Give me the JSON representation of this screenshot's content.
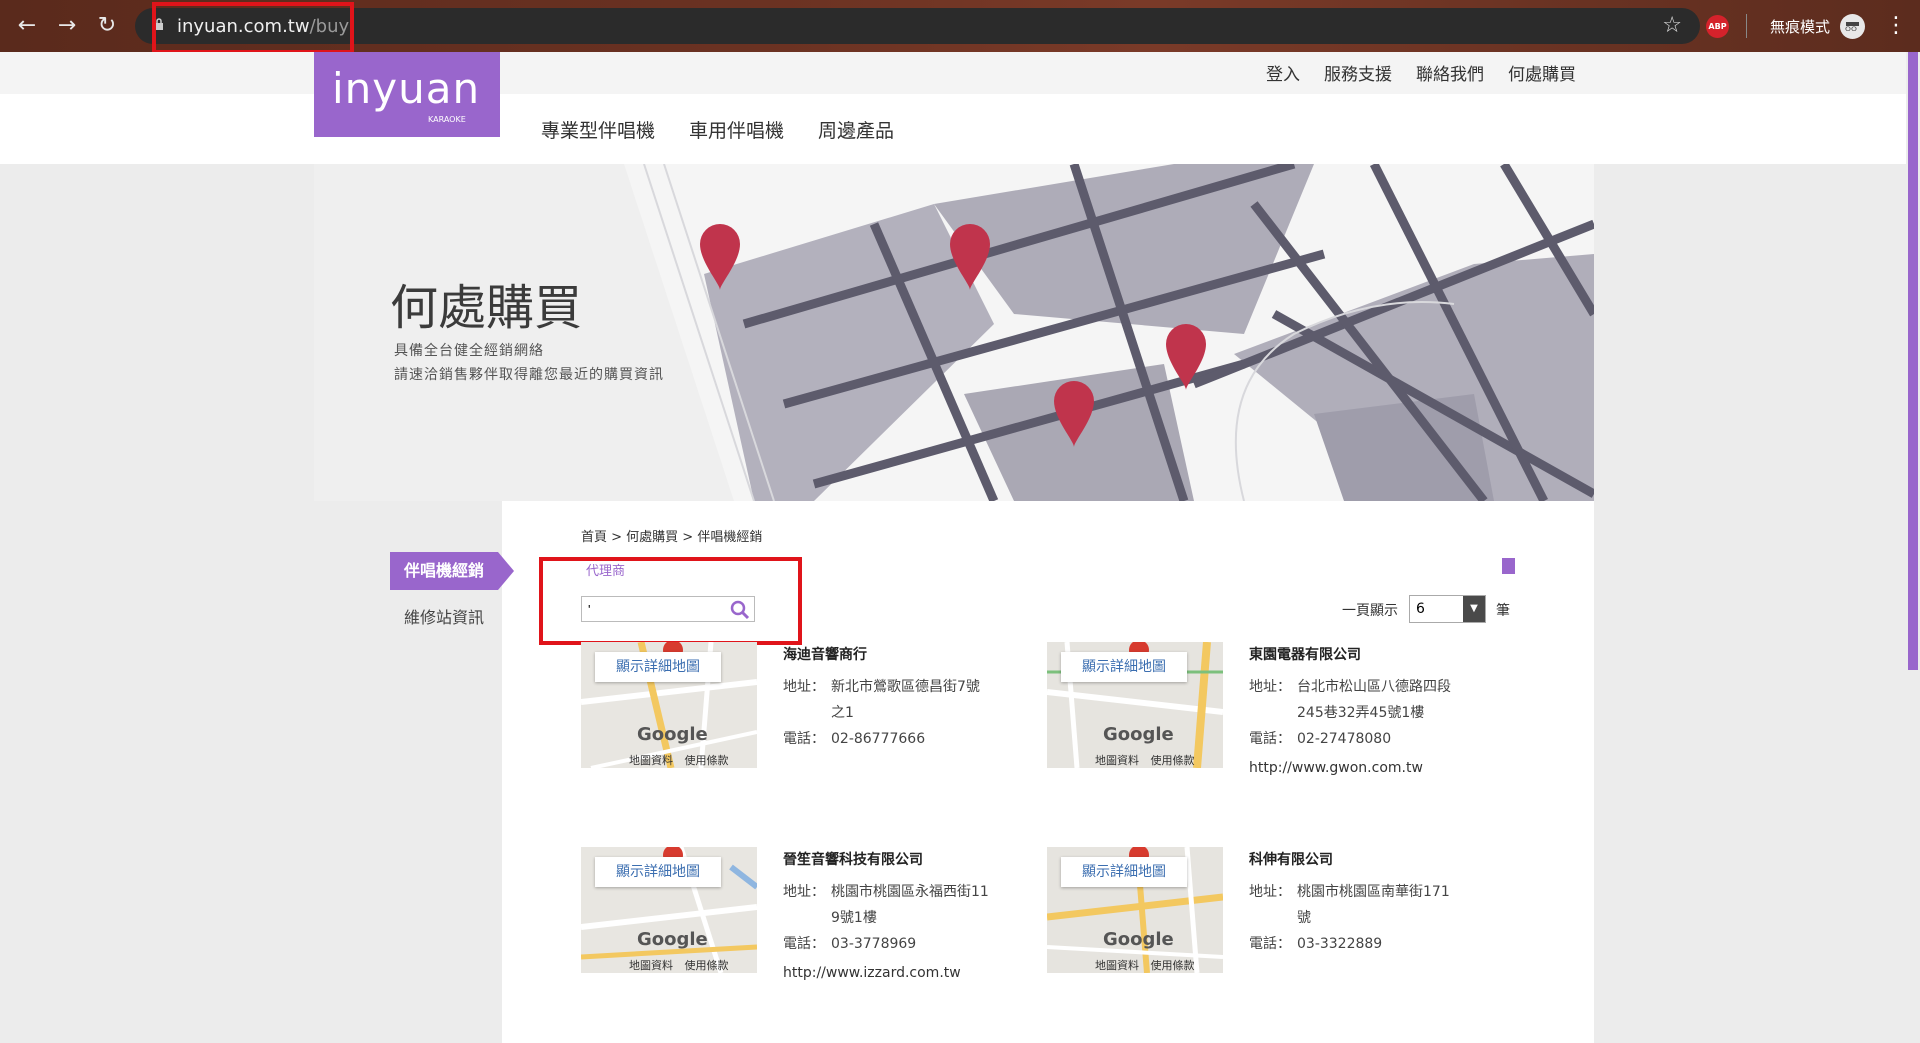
{
  "browser": {
    "url_host": "inyuan.com.tw",
    "url_path": "/buy",
    "abp_label": "ABP",
    "incognito_label": "無痕模式"
  },
  "site": {
    "logo_brand": "inyuan",
    "logo_sub": "KARAOKE",
    "top_links": [
      "登入",
      "服務支援",
      "聯絡我們",
      "何處購買"
    ],
    "main_nav": [
      "專業型伴唱機",
      "車用伴唱機",
      "周邊產品"
    ]
  },
  "banner": {
    "title": "何處購買",
    "sub1": "具備全台健全經銷網絡",
    "sub2": "請速洽銷售夥伴取得離您最近的購買資訊"
  },
  "sidebar": {
    "active": "伴唱機經銷",
    "item": "維修站資訊"
  },
  "breadcrumb": "首頁 > 何處購買 > 伴唱機經銷",
  "filter": {
    "agent_label": "代理商",
    "search_value": "'",
    "per_page_label": "一頁顯示",
    "per_page_value": "6",
    "per_page_unit": "筆"
  },
  "map_common": {
    "show_map": "顯示詳細地圖",
    "google": "Google",
    "footer": "地圖資料 使用條款"
  },
  "dealers": [
    {
      "name": "海迪音響商行",
      "addr_label": "地址：",
      "addr1": "新北市鶯歌區德昌街7號",
      "addr2": "之1",
      "phone_label": "電話：",
      "phone": "02-86777666",
      "web": ""
    },
    {
      "name": "東園電器有限公司",
      "addr_label": "地址：",
      "addr1": "台北市松山區八德路四段",
      "addr2": "245巷32弄45號1樓",
      "phone_label": "電話：",
      "phone": "02-27478080",
      "web": "http://www.gwon.com.tw"
    },
    {
      "name": "晉笙音響科技有限公司",
      "addr_label": "地址：",
      "addr1": "桃園市桃園區永福西街11",
      "addr2": "9號1樓",
      "phone_label": "電話：",
      "phone": "03-3778969",
      "web": "http://www.izzard.com.tw"
    },
    {
      "name": "科伸有限公司",
      "addr_label": "地址：",
      "addr1": "桃園市桃園區南華街171",
      "addr2": "號",
      "phone_label": "電話：",
      "phone": "03-3322889",
      "web": ""
    }
  ],
  "colors": {
    "accent": "#9966cc",
    "highlight": "#e0141a",
    "pin": "#c0344c"
  }
}
